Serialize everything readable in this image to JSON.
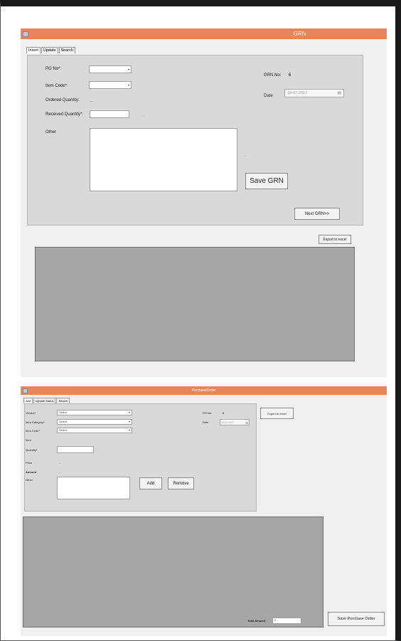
{
  "grn": {
    "title": "GRN",
    "tabs": [
      "Insert",
      "Update",
      "Search"
    ],
    "fields": {
      "po_no_label": "PO No*:",
      "item_code_label": "Item Code*:",
      "ordered_qty_label": "Ordered Quantity:",
      "ordered_qty_value": "..",
      "received_qty_label": "Received Quantity*:",
      "received_qty_hint": "..",
      "other_label": "Other",
      "other_hint": "..",
      "grn_no_label": "GRN No:",
      "grn_no_value": "6",
      "date_label": "Date",
      "date_value": "18-07-2017"
    },
    "buttons": {
      "save": "Save GRN",
      "next": "Next GRN>>",
      "export": "Export to excel"
    }
  },
  "purchase_order": {
    "title": "PurchaseOrder",
    "tabs": [
      "Add",
      "Update Status",
      "Search"
    ],
    "fields": {
      "vendor_label": "Vendor*",
      "vendor_value": "Select",
      "item_category_label": "Item Category*",
      "item_category_value": "Select",
      "item_code_label": "Item Code*",
      "item_code_value": "Select",
      "item_label": "Item",
      "quantity_label": "Quantity*",
      "price_label": "Price",
      "price_value": "..",
      "amount_label": "Amount",
      "amount_value": "...",
      "other_label": "Other",
      "po_no_label": "PO No:",
      "po_no_value": "6",
      "date_label": "Date",
      "date_value": "18-07-2017"
    },
    "buttons": {
      "add": "Add",
      "remove": "Remove",
      "export": "Export to excel",
      "save": "Save Purchase Order"
    },
    "total": {
      "label": "Total Amount",
      "value": "0"
    }
  },
  "icons": {
    "dropdown": "▾",
    "calendar": "▤"
  },
  "colors": {
    "titlebar": "#e8855d",
    "grid": "#a6a6a6"
  }
}
